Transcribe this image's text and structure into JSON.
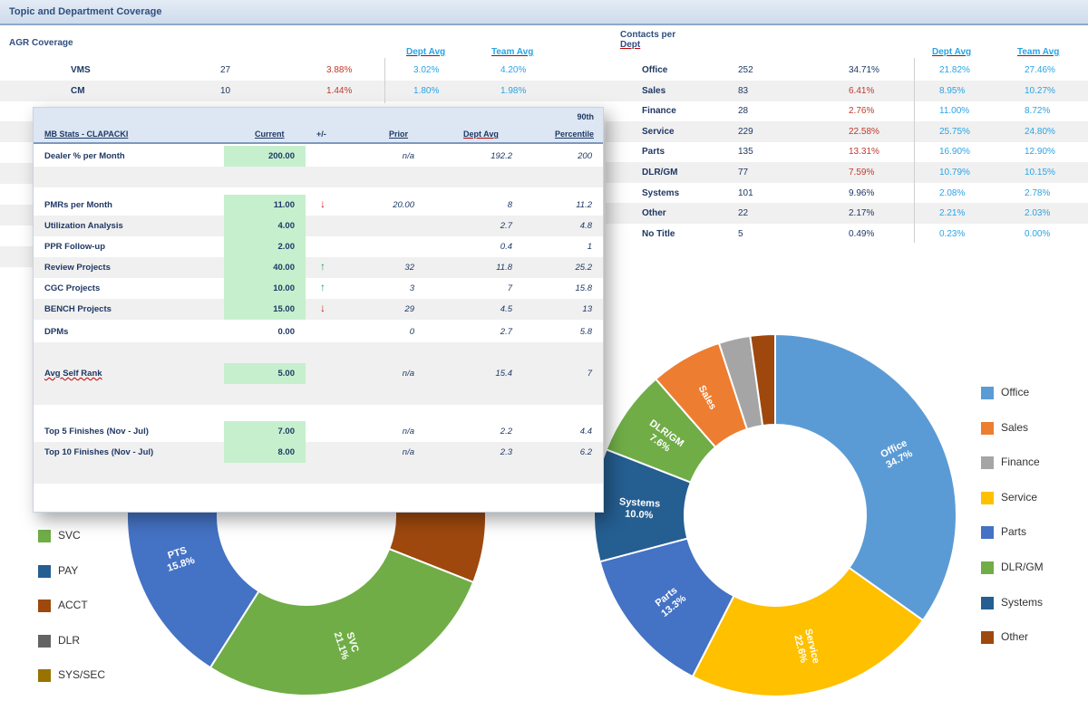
{
  "window": {
    "title": "Topic and Department Coverage"
  },
  "agr_section": {
    "label": "AGR Coverage",
    "col_headers": [
      "Dept Avg",
      "Team Avg"
    ],
    "rows": [
      {
        "name": "VMS",
        "count": "27",
        "pct": "3.88%",
        "dept": "3.02%",
        "team": "4.20%"
      },
      {
        "name": "CM",
        "count": "10",
        "pct": "1.44%",
        "dept": "1.80%",
        "team": "1.98%"
      }
    ]
  },
  "contacts_section": {
    "label_line1": "Contacts per",
    "label_line2": "Dept",
    "col_headers": [
      "Dept Avg",
      "Team Avg"
    ],
    "rows": [
      {
        "name": "Office",
        "count": "252",
        "pct": "34.71%",
        "pct_color": "dark",
        "dept": "21.82%",
        "team": "27.46%"
      },
      {
        "name": "Sales",
        "count": "83",
        "pct": "6.41%",
        "pct_color": "red",
        "dept": "8.95%",
        "team": "10.27%"
      },
      {
        "name": "Finance",
        "count": "28",
        "pct": "2.76%",
        "pct_color": "red",
        "dept": "11.00%",
        "team": "8.72%"
      },
      {
        "name": "Service",
        "count": "229",
        "pct": "22.58%",
        "pct_color": "red",
        "dept": "25.75%",
        "team": "24.80%"
      },
      {
        "name": "Parts",
        "count": "135",
        "pct": "13.31%",
        "pct_color": "red",
        "dept": "16.90%",
        "team": "12.90%"
      },
      {
        "name": "DLR/GM",
        "count": "77",
        "pct": "7.59%",
        "pct_color": "red",
        "dept": "10.79%",
        "team": "10.15%"
      },
      {
        "name": "Systems",
        "count": "101",
        "pct": "9.96%",
        "pct_color": "dark",
        "dept": "2.08%",
        "team": "2.78%"
      },
      {
        "name": "Other",
        "count": "22",
        "pct": "2.17%",
        "pct_color": "dark",
        "dept": "2.21%",
        "team": "2.03%"
      },
      {
        "name": "No Title",
        "count": "5",
        "pct": "0.49%",
        "pct_color": "dark",
        "dept": "0.23%",
        "team": "0.00%"
      }
    ]
  },
  "popup": {
    "headers": {
      "name": "MB Stats - CLAPACKI",
      "current": "Current",
      "change": "+/-",
      "prior": "Prior",
      "dept_avg": "Dept Avg",
      "percentile_1": "90th",
      "percentile_2": "Percentile"
    },
    "rows": [
      {
        "label": "Dealer % per Month",
        "current": "200.00",
        "arrow": "",
        "prior": "n/a",
        "dept": "192.2",
        "pct": "200",
        "green": true
      },
      {
        "label": "",
        "current": "",
        "arrow": "",
        "prior": "",
        "dept": "",
        "pct": "",
        "green": false
      },
      {
        "label": "PMRs per Month",
        "current": "11.00",
        "arrow": "down",
        "prior": "20.00",
        "dept": "8",
        "pct": "11.2",
        "green": true
      },
      {
        "label": "Utilization Analysis",
        "current": "4.00",
        "arrow": "",
        "prior": "",
        "dept": "2.7",
        "pct": "4.8",
        "green": true
      },
      {
        "label": "PPR Follow-up",
        "current": "2.00",
        "arrow": "",
        "prior": "",
        "dept": "0.4",
        "pct": "1",
        "green": true
      },
      {
        "label": "Review Projects",
        "current": "40.00",
        "arrow": "up",
        "prior": "32",
        "dept": "11.8",
        "pct": "25.2",
        "green": true
      },
      {
        "label": "CGC Projects",
        "current": "10.00",
        "arrow": "up",
        "prior": "3",
        "dept": "7",
        "pct": "15.8",
        "green": true
      },
      {
        "label": "BENCH Projects",
        "current": "15.00",
        "arrow": "down",
        "prior": "29",
        "dept": "4.5",
        "pct": "13",
        "green": true
      },
      {
        "label": "DPMs",
        "current": "0.00",
        "arrow": "",
        "prior": "0",
        "dept": "2.7",
        "pct": "5.8",
        "green": false
      },
      {
        "label": "Avg Self Rank",
        "current": "5.00",
        "arrow": "",
        "prior": "n/a",
        "dept": "15.4",
        "pct": "7",
        "green": true
      },
      {
        "label": "Top 5 Finishes (Nov - Jul)",
        "current": "7.00",
        "arrow": "",
        "prior": "n/a",
        "dept": "2.2",
        "pct": "4.4",
        "green": true
      },
      {
        "label": "Top 10 Finishes (Nov - Jul)",
        "current": "8.00",
        "arrow": "",
        "prior": "n/a",
        "dept": "2.3",
        "pct": "6.2",
        "green": true
      }
    ]
  },
  "chart_right": {
    "type": "pie",
    "slices": [
      {
        "name": "Office",
        "value": 34.7,
        "color": "#5b9bd5",
        "label": "Office\n34.7%"
      },
      {
        "name": "Service",
        "value": 22.6,
        "color": "#ffc000",
        "label": "Service\n22.6%"
      },
      {
        "name": "Parts",
        "value": 13.3,
        "color": "#4472c4",
        "label": "Parts\n13.3%"
      },
      {
        "name": "Systems",
        "value": 10.0,
        "color": "#255e91",
        "label": "Systems\n10.0%"
      },
      {
        "name": "DLR/GM",
        "value": 7.6,
        "color": "#70ad47",
        "label": "DLR/GM\n7.6%"
      },
      {
        "name": "Sales",
        "value": 6.4,
        "color": "#ed7d31",
        "label": "Sales"
      },
      {
        "name": "Finance",
        "value": 2.8,
        "color": "#a5a5a5",
        "label": ""
      },
      {
        "name": "Other",
        "value": 2.2,
        "color": "#9e480e",
        "label": ""
      }
    ],
    "legend": [
      {
        "name": "Office",
        "color": "#5b9bd5"
      },
      {
        "name": "Sales",
        "color": "#ed7d31"
      },
      {
        "name": "Finance",
        "color": "#a5a5a5"
      },
      {
        "name": "Service",
        "color": "#ffc000"
      },
      {
        "name": "Parts",
        "color": "#4472c4"
      },
      {
        "name": "DLR/GM",
        "color": "#70ad47"
      },
      {
        "name": "Systems",
        "color": "#255e91"
      },
      {
        "name": "Other",
        "color": "#9e480e"
      }
    ]
  },
  "chart_left": {
    "type": "pie",
    "slices_visible": [
      {
        "name": "ACCT",
        "value": 22.0,
        "color": "#9e480e",
        "label": ""
      },
      {
        "name": "SVC",
        "value": 21.1,
        "color": "#70ad47",
        "label": "SVC\n21.1%"
      },
      {
        "name": "PTS",
        "value": 15.8,
        "color": "#4472c4",
        "label": "PTS\n15.8%"
      }
    ],
    "legend": [
      {
        "name": "SVC",
        "color": "#70ad47"
      },
      {
        "name": "PAY",
        "color": "#255e91"
      },
      {
        "name": "ACCT",
        "color": "#9e480e"
      },
      {
        "name": "DLR",
        "color": "#636363"
      },
      {
        "name": "SYS/SEC",
        "color": "#997300"
      }
    ]
  }
}
